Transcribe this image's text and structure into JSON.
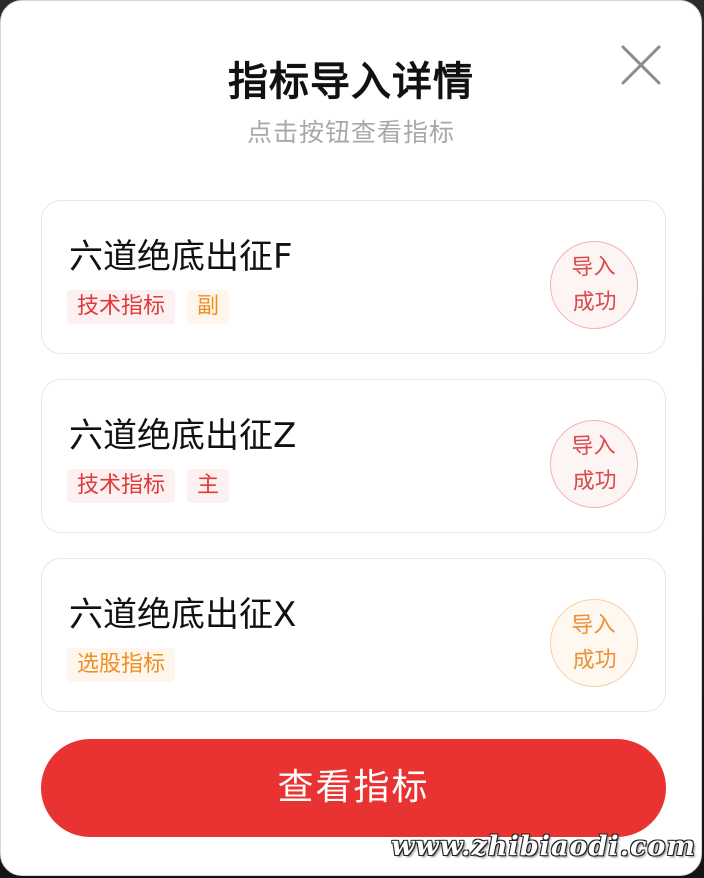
{
  "dialog": {
    "title": "指标导入详情",
    "subtitle": "点击按钮查看指标",
    "close_icon": "close-icon"
  },
  "indicators": [
    {
      "name": "六道绝底出征F",
      "tags": [
        {
          "label": "技术指标",
          "color": "red"
        },
        {
          "label": "副",
          "color": "orange"
        }
      ],
      "status_line1": "导入",
      "status_line2": "成功",
      "status_color": "red"
    },
    {
      "name": "六道绝底出征Z",
      "tags": [
        {
          "label": "技术指标",
          "color": "red"
        },
        {
          "label": "主",
          "color": "red"
        }
      ],
      "status_line1": "导入",
      "status_line2": "成功",
      "status_color": "red"
    },
    {
      "name": "六道绝底出征X",
      "tags": [
        {
          "label": "选股指标",
          "color": "orange"
        }
      ],
      "status_line1": "导入",
      "status_line2": "成功",
      "status_color": "orange"
    }
  ],
  "actions": {
    "view_indicators_label": "查看指标"
  },
  "watermark": "www.zhibiaodi.com",
  "colors": {
    "primary_red": "#e93232",
    "tag_red": "#e0393b",
    "tag_orange": "#ee8f21"
  }
}
